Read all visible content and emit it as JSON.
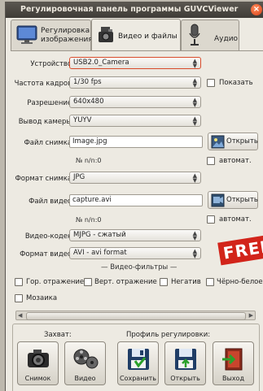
{
  "window": {
    "title": "Регулировочная панель программы GUVCViewer"
  },
  "tabs": [
    {
      "line1": "Регулировка",
      "line2": "изображения",
      "icon": "monitor-icon"
    },
    {
      "line1": "Видео и файлы",
      "icon": "camera-icon"
    },
    {
      "line1": "Аудио",
      "icon": "microphone-icon"
    }
  ],
  "device": {
    "label": "Устройство:",
    "value": "USB2.0_Camera"
  },
  "framerate": {
    "label": "Частота кадров:",
    "value": "1/30 fps",
    "show_label": "Показать"
  },
  "resolution": {
    "label": "Разрешение:",
    "value": "640x480"
  },
  "camera_output": {
    "label": "Вывод камеры:",
    "value": "YUYV"
  },
  "image_file": {
    "label": "Файл снимка:",
    "value": "Image.jpg",
    "open_label": "Открыть",
    "counter": "№ n/n:0",
    "auto_label": "автомат."
  },
  "image_format": {
    "label": "Формат снимка:",
    "value": "JPG"
  },
  "video_file": {
    "label": "Файл видео:",
    "value": "capture.avi",
    "open_label": "Открыть",
    "counter": "№ n/n:0",
    "auto_label": "автомат."
  },
  "video_codec": {
    "label": "Видео-кодек:",
    "value": "MJPG - сжатый"
  },
  "video_format": {
    "label": "Формат видео:",
    "value": "AVI - avi format"
  },
  "filters": {
    "title": "— Видео-фильтры —",
    "items": [
      "Гор. отражение",
      "Верт. отражение",
      "Негатив",
      "Чёрно-белое",
      "Мозаика"
    ]
  },
  "stamp": "FREE",
  "bottom": {
    "capture_label": "Захват:",
    "profile_label": "Профиль регулировки:",
    "buttons": [
      {
        "label": "Снимок",
        "icon": "photo-camera-icon"
      },
      {
        "label": "Видео",
        "icon": "film-reel-icon"
      },
      {
        "label": "Сохранить",
        "icon": "save-icon"
      },
      {
        "label": "Открыть",
        "icon": "open-profile-icon"
      },
      {
        "label": "Выход",
        "icon": "exit-door-icon"
      }
    ]
  },
  "colors": {
    "accent_red": "#d84b2b",
    "titlebar": "#4a4640"
  }
}
